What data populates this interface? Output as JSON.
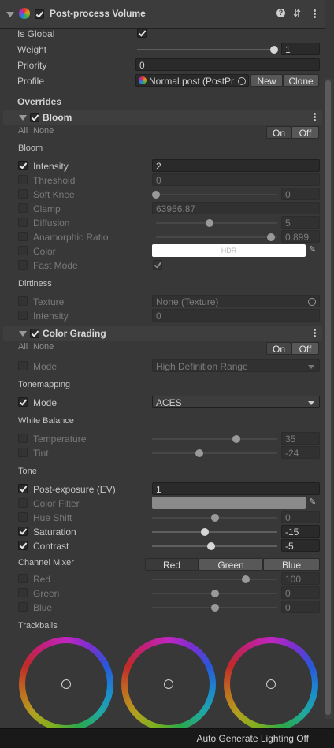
{
  "header": {
    "title": "Post-process Volume"
  },
  "volume": {
    "is_global_label": "Is Global",
    "weight_label": "Weight",
    "weight_value": "1",
    "weight_fraction": 1.0,
    "priority_label": "Priority",
    "priority_value": "0",
    "profile_label": "Profile",
    "profile_value": "Normal post (PostPr",
    "new_label": "New",
    "clone_label": "Clone"
  },
  "overrides_label": "Overrides",
  "all_label": "All",
  "none_label": "None",
  "on_label": "On",
  "off_label": "Off",
  "bloom": {
    "title": "Bloom",
    "section": "Bloom",
    "intensity_label": "Intensity",
    "intensity_value": "2",
    "threshold_label": "Threshold",
    "threshold_value": "0",
    "soft_knee_label": "Soft Knee",
    "soft_knee_value": "0",
    "soft_knee_fraction": 0.0,
    "clamp_label": "Clamp",
    "clamp_value": "63956.87",
    "diffusion_label": "Diffusion",
    "diffusion_value": "5",
    "diffusion_fraction": 0.44,
    "anamorphic_label": "Anamorphic Ratio",
    "anamorphic_value": "0.899",
    "anamorphic_fraction": 0.95,
    "color_label": "Color",
    "color_value": "HDR",
    "fast_mode_label": "Fast Mode",
    "dirtiness_section": "Dirtiness",
    "texture_label": "Texture",
    "texture_value": "None (Texture)",
    "dirt_intensity_label": "Intensity",
    "dirt_intensity_value": "0"
  },
  "grading": {
    "title": "Color Grading",
    "mode_label": "Mode",
    "mode_value": "High Definition Range",
    "tonemapping_section": "Tonemapping",
    "tm_mode_label": "Mode",
    "tm_mode_value": "ACES",
    "white_balance_section": "White Balance",
    "temperature_label": "Temperature",
    "temperature_value": "35",
    "temperature_fraction": 0.67,
    "tint_label": "Tint",
    "tint_value": "-24",
    "tint_fraction": 0.38,
    "tone_section": "Tone",
    "post_exposure_label": "Post-exposure (EV)",
    "post_exposure_value": "1",
    "color_filter_label": "Color Filter",
    "hue_shift_label": "Hue Shift",
    "hue_shift_value": "0",
    "hue_shift_fraction": 0.5,
    "saturation_label": "Saturation",
    "saturation_value": "-15",
    "saturation_fraction": 0.42,
    "contrast_label": "Contrast",
    "contrast_value": "-5",
    "contrast_fraction": 0.47,
    "channel_mixer_section": "Channel Mixer",
    "mixer_tabs": [
      "Red",
      "Green",
      "Blue"
    ],
    "red_label": "Red",
    "red_value": "100",
    "red_fraction": 0.75,
    "green_label": "Green",
    "green_value": "0",
    "green_fraction": 0.5,
    "blue_label": "Blue",
    "blue_value": "0",
    "blue_fraction": 0.5,
    "trackballs_section": "Trackballs"
  },
  "status": {
    "text": "Auto Generate Lighting Off"
  },
  "colors": {
    "accent": "#7a7a7a",
    "background": "#383838",
    "field": "#2a2a2a"
  }
}
